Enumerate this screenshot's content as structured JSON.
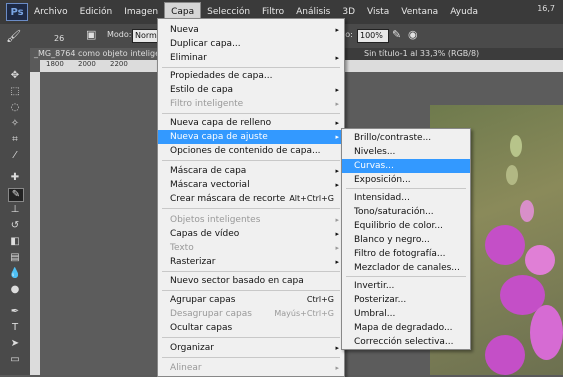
{
  "menubar": {
    "logo": "Ps",
    "items": [
      "Archivo",
      "Edición",
      "Imagen",
      "Capa",
      "Selección",
      "Filtro",
      "Análisis",
      "3D",
      "Vista",
      "Ventana",
      "Ayuda"
    ],
    "zoom_value": "16,7"
  },
  "options": {
    "brush_size": "26",
    "mode_label": "Modo:",
    "mode_value": "Normal",
    "flow_label": "jo:",
    "flow_value": "100%"
  },
  "tabs": {
    "doc1": "_MG_8764 como objeto intelige",
    "doc2": "Sin título-1 al 33,3% (RGB/8)"
  },
  "ruler": [
    "1800",
    "2000",
    "2200"
  ],
  "capa_menu": {
    "items": [
      {
        "label": "Nueva",
        "arrow": "▸"
      },
      {
        "label": "Duplicar capa..."
      },
      {
        "label": "Eliminar",
        "arrow": "▸"
      },
      {
        "label": "Propiedades de capa..."
      },
      {
        "label": "Estilo de capa",
        "arrow": "▸"
      },
      {
        "label": "Filtro inteligente",
        "arrow": "▸"
      },
      {
        "label": "Nueva capa de relleno",
        "arrow": "▸"
      },
      {
        "label": "Nueva capa de ajuste",
        "arrow": "▸"
      },
      {
        "label": "Opciones de contenido de capa..."
      },
      {
        "label": "Máscara de capa",
        "arrow": "▸"
      },
      {
        "label": "Máscara vectorial",
        "arrow": "▸"
      },
      {
        "label": "Crear máscara de recorte",
        "shortcut": "Alt+Ctrl+G"
      },
      {
        "label": "Objetos inteligentes",
        "arrow": "▸"
      },
      {
        "label": "Capas de vídeo",
        "arrow": "▸"
      },
      {
        "label": "Texto",
        "arrow": "▸"
      },
      {
        "label": "Rasterizar",
        "arrow": "▸"
      },
      {
        "label": "Nuevo sector basado en capa"
      },
      {
        "label": "Agrupar capas",
        "shortcut": "Ctrl+G"
      },
      {
        "label": "Desagrupar capas",
        "shortcut": "Mayús+Ctrl+G"
      },
      {
        "label": "Ocultar capas"
      },
      {
        "label": "Organizar",
        "arrow": "▸"
      },
      {
        "label": "Alinear",
        "arrow": "▸"
      }
    ]
  },
  "adjust_submenu": {
    "items": [
      "Brillo/contraste...",
      "Niveles...",
      "Curvas...",
      "Exposición...",
      "Intensidad...",
      "Tono/saturación...",
      "Equilibrio de color...",
      "Blanco y negro...",
      "Filtro de fotografía...",
      "Mezclador de canales...",
      "Invertir...",
      "Posterizar...",
      "Umbral...",
      "Mapa de degradado...",
      "Corrección selectiva..."
    ]
  }
}
